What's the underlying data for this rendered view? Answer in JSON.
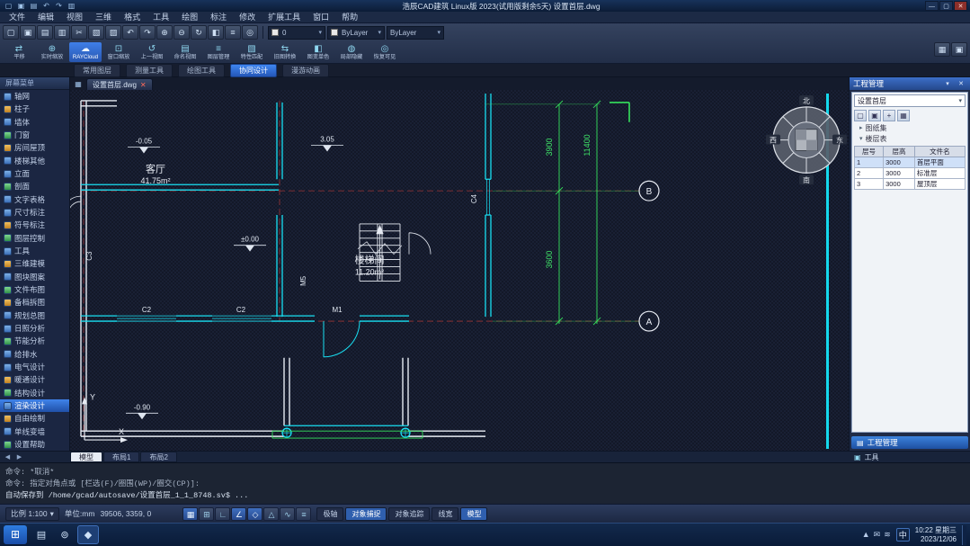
{
  "titlebar": {
    "title": "浩辰CAD建筑 Linux版 2023(试用版剩余5天)  设置首层.dwg",
    "quick_icons": [
      {
        "name": "new-icon",
        "glyph": "▢"
      },
      {
        "name": "open-icon",
        "glyph": "▣"
      },
      {
        "name": "save-icon",
        "glyph": "▤"
      },
      {
        "name": "undo-icon",
        "glyph": "↶"
      },
      {
        "name": "redo-icon",
        "glyph": "↷"
      },
      {
        "name": "plot-icon",
        "glyph": "▥"
      }
    ],
    "window_buttons": [
      {
        "name": "minimize-button",
        "glyph": "—"
      },
      {
        "name": "maximize-button",
        "glyph": "▢"
      },
      {
        "name": "close-button",
        "glyph": "✕"
      }
    ]
  },
  "menubar": {
    "items": [
      "文件",
      "编辑",
      "视图",
      "三维",
      "格式",
      "工具",
      "绘图",
      "标注",
      "修改",
      "扩展工具",
      "窗口",
      "帮助"
    ]
  },
  "icons": {
    "dropdown_arrow": "▾"
  },
  "toolbar": {
    "row1_icons": [
      {
        "name": "new-icon",
        "glyph": "▢"
      },
      {
        "name": "open-icon",
        "glyph": "▣"
      },
      {
        "name": "save-icon",
        "glyph": "▤"
      },
      {
        "name": "plot-icon",
        "glyph": "▥"
      },
      {
        "name": "cut-icon",
        "glyph": "✂"
      },
      {
        "name": "copy-icon",
        "glyph": "▧"
      },
      {
        "name": "paste-icon",
        "glyph": "▨"
      },
      {
        "name": "undo-icon",
        "glyph": "↶"
      },
      {
        "name": "redo-icon",
        "glyph": "↷"
      },
      {
        "name": "zoom-in-icon",
        "glyph": "⊕"
      },
      {
        "name": "zoom-out-icon",
        "glyph": "⊖"
      },
      {
        "name": "regen-icon",
        "glyph": "↻"
      },
      {
        "name": "match-properties-icon",
        "glyph": "◧"
      },
      {
        "name": "layers-icon",
        "glyph": "≡"
      },
      {
        "name": "find-icon",
        "glyph": "◎"
      }
    ],
    "combos": [
      {
        "name": "layer-combo",
        "value": "0"
      },
      {
        "name": "color-combo",
        "value": "ByLayer"
      },
      {
        "name": "linetype-combo",
        "value": "ByLayer"
      }
    ],
    "row2_buttons": [
      {
        "name": "pan-button",
        "label": "平移",
        "glyph": "⇄"
      },
      {
        "name": "zoom-realtime-button",
        "label": "实时缩放",
        "glyph": "⊕"
      },
      {
        "name": "raycloud-button",
        "label": "RAYCloud",
        "glyph": "☁",
        "active": true
      },
      {
        "name": "zoom-window-button",
        "label": "窗口缩放",
        "glyph": "⊡"
      },
      {
        "name": "zoom-previous-button",
        "label": "上一视图",
        "glyph": "↺"
      },
      {
        "name": "named-views-button",
        "label": "命名视图",
        "glyph": "▤"
      },
      {
        "name": "layer-manager-button",
        "label": "图层管理",
        "glyph": "≡"
      },
      {
        "name": "match-button",
        "label": "特性匹配",
        "glyph": "▧"
      },
      {
        "name": "convert-drawing-button",
        "label": "旧图转换",
        "glyph": "⇆"
      },
      {
        "name": "monochrome-button",
        "label": "图变单色",
        "glyph": "◧"
      },
      {
        "name": "hide-partial-button",
        "label": "局部隐藏",
        "glyph": "◍"
      },
      {
        "name": "restore-visible-button",
        "label": "恢复可见",
        "glyph": "◎"
      }
    ],
    "panel_toggles": [
      {
        "name": "properties-panel-icon",
        "glyph": "▦"
      },
      {
        "name": "tool-palette-icon",
        "glyph": "▣"
      }
    ]
  },
  "ribbon_tabs": {
    "items": [
      {
        "name": "tab-common-layers",
        "label": "常用图层"
      },
      {
        "name": "tab-measure-tools",
        "label": "测量工具"
      },
      {
        "name": "tab-draw-tools",
        "label": "绘图工具"
      },
      {
        "name": "tab-collab-design",
        "label": "协同设计",
        "active": true
      },
      {
        "name": "tab-walkthrough",
        "label": "漫游动画"
      }
    ]
  },
  "left_panel": {
    "header": "屏幕菜单",
    "items": [
      {
        "label": "轴网"
      },
      {
        "label": "柱子"
      },
      {
        "label": "墙体"
      },
      {
        "label": "门窗"
      },
      {
        "label": "房间屋顶"
      },
      {
        "label": "楼梯其他"
      },
      {
        "label": "立面"
      },
      {
        "label": "剖面"
      },
      {
        "label": "文字表格"
      },
      {
        "label": "尺寸标注"
      },
      {
        "label": "符号标注"
      },
      {
        "label": "图层控制"
      },
      {
        "label": "工具"
      },
      {
        "label": "三维建模"
      },
      {
        "label": "图块图案"
      },
      {
        "label": "文件布图"
      },
      {
        "label": "备档拆图"
      },
      {
        "label": "规划总图"
      },
      {
        "label": "日照分析"
      },
      {
        "label": "节能分析"
      },
      {
        "label": "给排水"
      },
      {
        "label": "电气设计"
      },
      {
        "label": "暖通设计"
      },
      {
        "label": "结构设计"
      },
      {
        "label": "渲染设计",
        "active": true
      },
      {
        "label": "自由绘制"
      },
      {
        "label": "单线变墙"
      },
      {
        "label": "设置帮助"
      }
    ]
  },
  "doc_tabs": {
    "icon": "▦",
    "tabs": [
      {
        "label": "设置首层.dwg",
        "close": "✕"
      }
    ]
  },
  "canvas": {
    "rooms": [
      {
        "name": "客厅",
        "area": "41.75m²"
      },
      {
        "name": "楼梯间",
        "area": "11.20m²"
      }
    ],
    "dims": [
      "3900",
      "3600",
      "11400"
    ],
    "axis_bubbles": [
      "B",
      "A"
    ],
    "tags": [
      "C2",
      "C2",
      "M1",
      "M5",
      "C4",
      "C3"
    ],
    "elevations": [
      "-0.05",
      "3.05",
      "±0.00",
      "-0.90"
    ],
    "compass": {
      "labels": [
        "北",
        "东",
        "南",
        "西"
      ]
    },
    "ucs": {
      "x": "X",
      "y": "Y"
    }
  },
  "right_panel": {
    "title": "工程管理",
    "header_icons": [
      {
        "name": "pin-icon",
        "glyph": "▾"
      },
      {
        "name": "close-panel-icon",
        "glyph": "✕"
      }
    ],
    "combo_value": "设置首层",
    "tools": [
      {
        "name": "new-project-icon",
        "glyph": "▢"
      },
      {
        "name": "open-project-icon",
        "glyph": "▣"
      },
      {
        "name": "add-sheet-icon",
        "glyph": "+"
      },
      {
        "name": "settings-icon",
        "glyph": "▦"
      }
    ],
    "tree": [
      {
        "glyph": "▸",
        "label": "图纸集"
      },
      {
        "glyph": "▾",
        "label": "楼层表"
      }
    ],
    "table": {
      "headers": [
        "层号",
        "层高",
        "文件名"
      ],
      "rows": [
        {
          "active": true,
          "cells": [
            "1",
            "3000",
            "首层平面"
          ]
        },
        {
          "cells": [
            "2",
            "3000",
            "标准层"
          ]
        },
        {
          "cells": [
            "3",
            "3000",
            "屋顶层"
          ]
        }
      ]
    },
    "bottom_button": "工程管理",
    "tools_label": "工具"
  },
  "layout_tabs": {
    "scroll": [
      {
        "name": "tab-scroll-left-icon",
        "glyph": "◀"
      },
      {
        "name": "tab-scroll-right-icon",
        "glyph": "▶"
      }
    ],
    "items": [
      {
        "label": "模型",
        "active": true
      },
      {
        "label": "布局1"
      },
      {
        "label": "布局2"
      }
    ]
  },
  "command": {
    "lines": [
      "命令: *取消*",
      "命令: 指定对角点或 [栏选(F)/圈围(WP)/圈交(CP)]:",
      "自动保存到 /home/gcad/autosave/设置首层_1_1_8748.sv$ ..."
    ]
  },
  "statusbar": {
    "scale": "比例 1:100",
    "units": "单位:mm",
    "coords": "39506, 3359, 0",
    "toggles": [
      {
        "name": "snap-toggle",
        "glyph": "▦",
        "active": true
      },
      {
        "name": "grid-toggle",
        "glyph": "⊞"
      },
      {
        "name": "ortho-toggle",
        "glyph": "∟"
      },
      {
        "name": "polar-toggle",
        "glyph": "∠",
        "active": true
      },
      {
        "name": "osnap-toggle",
        "glyph": "◇",
        "active": true
      },
      {
        "name": "otrack-toggle",
        "glyph": "△"
      },
      {
        "name": "dyn-toggle",
        "glyph": "∿"
      },
      {
        "name": "lwt-toggle",
        "glyph": "≡"
      }
    ],
    "chips": [
      {
        "label": "极轴"
      },
      {
        "label": "对象捕捉",
        "active": true
      },
      {
        "label": "对象追踪"
      },
      {
        "label": "线宽"
      },
      {
        "label": "模型",
        "active": true
      }
    ]
  },
  "taskbar": {
    "start_glyph": "⊞",
    "apps": [
      {
        "name": "file-manager-icon",
        "glyph": "▤"
      },
      {
        "name": "browser-icon",
        "glyph": "⊚"
      },
      {
        "name": "cad-app-icon",
        "glyph": "◆",
        "active": true
      }
    ],
    "tray": [
      {
        "name": "arrow-up-icon",
        "glyph": "▲"
      },
      {
        "name": "mail-icon",
        "glyph": "✉"
      },
      {
        "name": "network-icon",
        "glyph": "≋"
      }
    ],
    "ime": "中",
    "clock_time": "10:22 星期三",
    "clock_date": "2023/12/06"
  }
}
